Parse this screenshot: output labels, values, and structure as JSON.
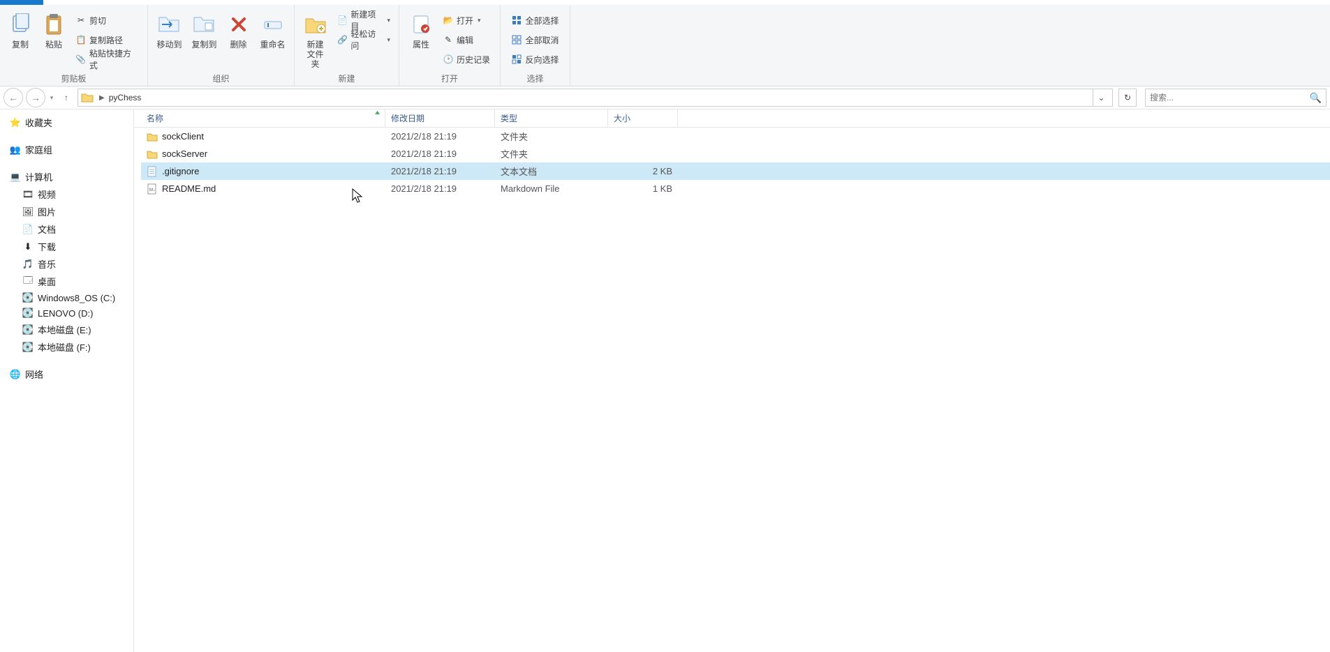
{
  "ribbon": {
    "clipboard": {
      "label": "剪贴板",
      "copy": "复制",
      "paste": "粘贴",
      "cut": "剪切",
      "copy_path": "复制路径",
      "paste_shortcut": "粘贴快捷方式"
    },
    "organize": {
      "label": "组织",
      "move_to": "移动到",
      "copy_to": "复制到",
      "delete": "删除",
      "rename": "重命名"
    },
    "new": {
      "label": "新建",
      "new_folder_line1": "新建",
      "new_folder_line2": "文件夹",
      "new_item": "新建项目",
      "easy_access": "轻松访问"
    },
    "open": {
      "label": "打开",
      "properties": "属性",
      "open": "打开",
      "edit": "编辑",
      "history": "历史记录"
    },
    "select": {
      "label": "选择",
      "select_all": "全部选择",
      "select_none": "全部取消",
      "invert": "反向选择"
    }
  },
  "nav": {
    "location": "pyChess",
    "search_placeholder": "搜索..."
  },
  "sidebar": {
    "favorites": "收藏夹",
    "homegroup": "家庭组",
    "computer": "计算机",
    "videos": "视频",
    "pictures": "图片",
    "documents": "文档",
    "downloads": "下载",
    "music": "音乐",
    "desktop": "桌面",
    "drive_c": "Windows8_OS (C:)",
    "drive_d": "LENOVO (D:)",
    "drive_e": "本地磁盘 (E:)",
    "drive_f": "本地磁盘 (F:)",
    "network": "网络"
  },
  "columns": {
    "name": "名称",
    "date": "修改日期",
    "type": "类型",
    "size": "大小"
  },
  "files": [
    {
      "name": "sockClient",
      "date": "2021/2/18 21:19",
      "type": "文件夹",
      "size": "",
      "icon": "folder",
      "selected": false
    },
    {
      "name": "sockServer",
      "date": "2021/2/18 21:19",
      "type": "文件夹",
      "size": "",
      "icon": "folder",
      "selected": false
    },
    {
      "name": ".gitignore",
      "date": "2021/2/18 21:19",
      "type": "文本文档",
      "size": "2 KB",
      "icon": "text",
      "selected": true
    },
    {
      "name": "README.md",
      "date": "2021/2/18 21:19",
      "type": "Markdown File",
      "size": "1 KB",
      "icon": "md",
      "selected": false
    }
  ]
}
